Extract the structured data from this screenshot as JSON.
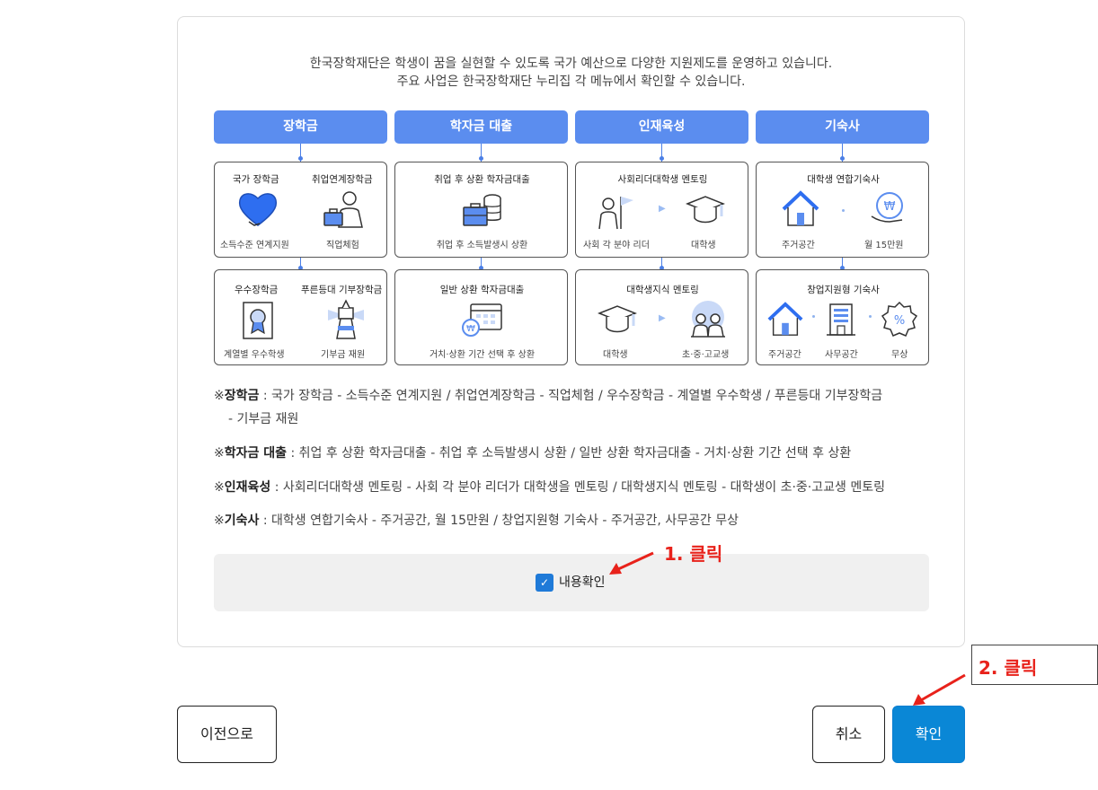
{
  "intro": {
    "line1": "한국장학재단은 학생이 꿈을 실현할 수 있도록 국가 예산으로 다양한 지원제도를 운영하고 있습니다.",
    "line2": "주요 사업은 한국장학재단 누리집 각 메뉴에서 확인할 수 있습니다."
  },
  "columns": [
    {
      "header": "장학금",
      "top": {
        "left_title": "국가 장학금",
        "right_title": "취업연계장학금",
        "left_caption": "소득수준 연계지원",
        "right_caption": "직업체험"
      },
      "bottom": {
        "left_title": "우수장학금",
        "right_title": "푸른등대 기부장학금",
        "left_caption": "계열별 우수학생",
        "right_caption": "기부금 재원"
      }
    },
    {
      "header": "학자금 대출",
      "top": {
        "title": "취업 후 상환 학자금대출",
        "caption": "취업 후 소득발생시 상환"
      },
      "bottom": {
        "title": "일반 상환 학자금대출",
        "caption": "거치·상환 기간 선택 후 상환"
      }
    },
    {
      "header": "인재육성",
      "top": {
        "title": "사회리더대학생 멘토링",
        "left_caption": "사회 각 분야 리더",
        "right_caption": "대학생"
      },
      "bottom": {
        "title": "대학생지식 멘토링",
        "left_caption": "대학생",
        "right_caption": "초·중·고교생"
      }
    },
    {
      "header": "기숙사",
      "top": {
        "title": "대학생 연합기숙사",
        "left_caption": "주거공간",
        "right_caption": "월 15만원"
      },
      "bottom": {
        "title": "창업지원형 기숙사",
        "caption1": "주거공간",
        "caption2": "사무공간",
        "caption3": "무상"
      }
    }
  ],
  "notes": [
    {
      "mark": "※",
      "term": "장학금",
      "text": " : 국가 장학금 - 소득수준 연계지원 / 취업연계장학금 - 직업체험 / 우수장학금 - 계열별 우수학생 / 푸른등대 기부장학금",
      "cont": "- 기부금 재원"
    },
    {
      "mark": "※",
      "term": "학자금 대출",
      "text": " : 취업 후 상환 학자금대출 - 취업 후 소득발생시 상환 / 일반 상환 학자금대출 - 거치·상환 기간 선택 후 상환"
    },
    {
      "mark": "※",
      "term": "인재육성",
      "text": " : 사회리더대학생 멘토링 - 사회 각 분야 리더가 대학생을 멘토링 / 대학생지식 멘토링 - 대학생이 초·중·고교생 멘토링"
    },
    {
      "mark": "※",
      "term": "기숙사",
      "text": " : 대학생 연합기숙사 - 주거공간, 월 15만원 / 창업지원형 기숙사 - 주거공간, 사무공간 무상"
    }
  ],
  "confirm": {
    "checkbox_label": "내용확인",
    "checked": true,
    "check_glyph": "✓"
  },
  "buttons": {
    "prev": "이전으로",
    "cancel": "취소",
    "ok": "확인"
  },
  "annotations": {
    "step1": "1. 클릭",
    "step2": "2. 클릭"
  },
  "colors": {
    "header_blue": "#5b8def",
    "ok_button": "#0a87d6",
    "checkbox": "#1f7ad8",
    "annotation_red": "#e8221b"
  }
}
